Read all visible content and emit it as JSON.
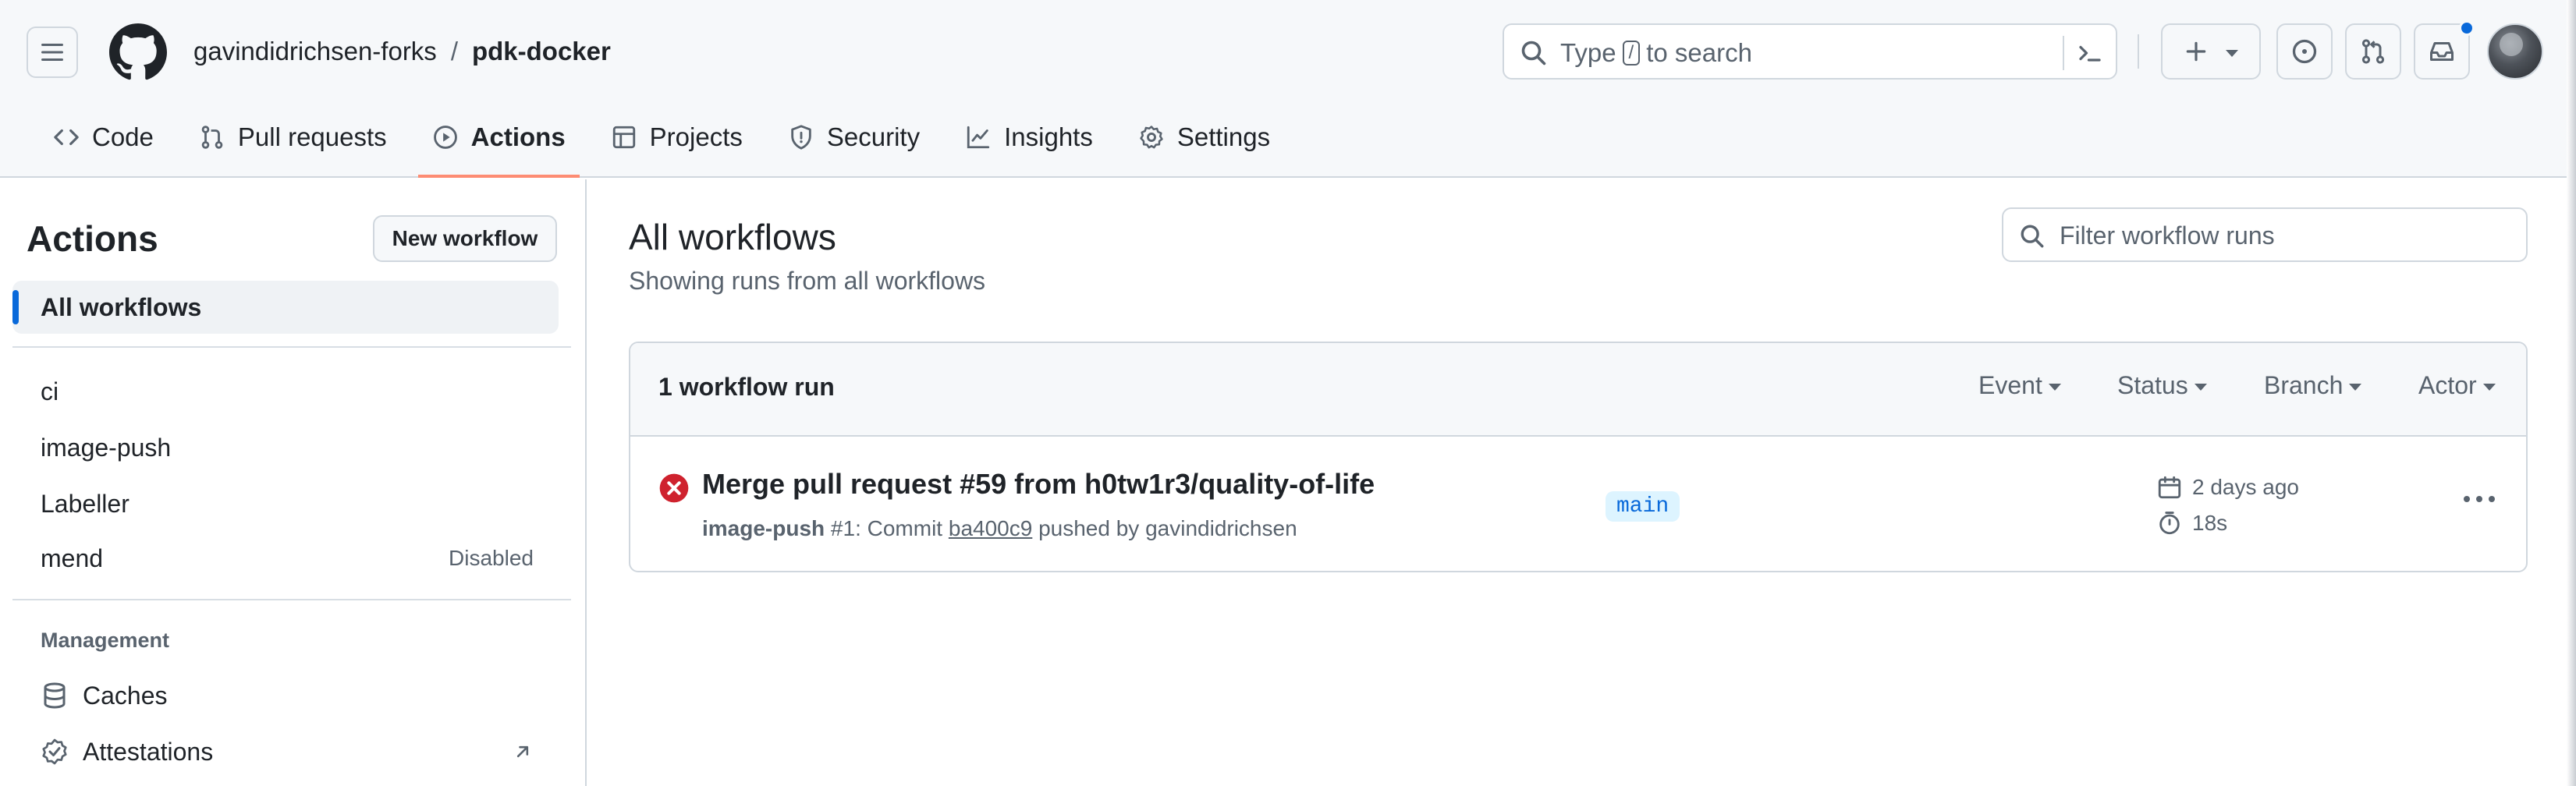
{
  "header": {
    "owner": "gavindidrichsen-forks",
    "separator": "/",
    "repo": "pdk-docker",
    "search": {
      "prefix": "Type",
      "key": "/",
      "suffix": "to search"
    },
    "icons": {
      "menu": "hamburger-icon",
      "logo": "github-logo",
      "command": "command-palette-icon",
      "create": "plus-icon",
      "issues": "issue-opened-icon",
      "pulls": "git-pull-request-icon",
      "inbox": "inbox-icon"
    },
    "notification_color": "#0969da"
  },
  "tabs": [
    {
      "label": "Code",
      "icon": "code-icon"
    },
    {
      "label": "Pull requests",
      "icon": "git-pull-request-icon"
    },
    {
      "label": "Actions",
      "icon": "play-icon",
      "active": true
    },
    {
      "label": "Projects",
      "icon": "table-icon"
    },
    {
      "label": "Security",
      "icon": "shield-icon"
    },
    {
      "label": "Insights",
      "icon": "graph-icon"
    },
    {
      "label": "Settings",
      "icon": "gear-icon"
    }
  ],
  "sidebar": {
    "title": "Actions",
    "new_workflow": "New workflow",
    "all_workflows": "All workflows",
    "workflows": [
      {
        "label": "ci",
        "badge": ""
      },
      {
        "label": "image-push",
        "badge": ""
      },
      {
        "label": "Labeller",
        "badge": ""
      },
      {
        "label": "mend",
        "badge": "Disabled"
      }
    ],
    "management_heading": "Management",
    "management": [
      {
        "label": "Caches",
        "icon": "database-icon"
      },
      {
        "label": "Attestations",
        "icon": "verified-icon"
      }
    ]
  },
  "main": {
    "title": "All workflows",
    "subtitle": "Showing runs from all workflows",
    "filter_placeholder": "Filter workflow runs",
    "run_count": "1 workflow run",
    "filters": [
      "Event",
      "Status",
      "Branch",
      "Actor"
    ],
    "runs": [
      {
        "status": "failure",
        "status_color": "#cf222e",
        "title": "Merge pull request #59 from h0tw1r3/quality-of-life",
        "workflow": "image-push",
        "run_number": "#1:",
        "commit_prefix": "Commit",
        "sha": "ba400c9",
        "pushed_by": "pushed by gavindidrichsen",
        "branch": "main",
        "date": "2 days ago",
        "duration": "18s"
      }
    ]
  }
}
